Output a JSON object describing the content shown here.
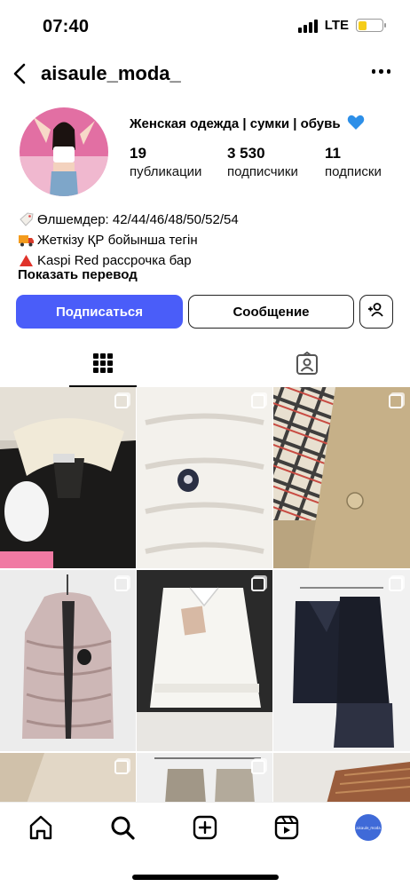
{
  "status_bar": {
    "time": "07:40",
    "network": "LTE",
    "battery_level": 0.35,
    "battery_color": "#f5cd19"
  },
  "header": {
    "username": "aisaule_moda_",
    "back_icon": "chevron-left-icon",
    "more_icon": "more-horizontal-icon"
  },
  "profile": {
    "name": "Женская одежда | сумки | обувь",
    "name_emoji": "blue-heart-icon",
    "stats": [
      {
        "value": "19",
        "label": "публикации"
      },
      {
        "value": "3 530",
        "label": "подписчики"
      },
      {
        "value": "11",
        "label": "подписки"
      }
    ],
    "bio": [
      {
        "icon": "tag-icon",
        "text": "Өлшемдер: 42/44/46/48/50/52/54"
      },
      {
        "icon": "truck-icon",
        "text": "Жеткізу ҚР бойынша тегін"
      },
      {
        "icon": "red-triangle-icon",
        "text": "Kaspi Red рассрочка бар"
      }
    ],
    "translate_link": "Показать перевод"
  },
  "actions": {
    "follow_label": "Подписаться",
    "message_label": "Сообщение",
    "follow_color": "#4a5df9"
  },
  "tabs": [
    {
      "name": "grid-icon",
      "active": true
    },
    {
      "name": "tagged-icon",
      "active": false
    }
  ],
  "grid": {
    "posts": [
      {
        "subject": "black leather jacket with shearling collar"
      },
      {
        "subject": "white puffer detail with logo patch"
      },
      {
        "subject": "beige trench with check lining"
      },
      {
        "subject": "pink puffer vest"
      },
      {
        "subject": "white blouse with lace trim"
      },
      {
        "subject": "black knit set with lace skirt"
      },
      {
        "subject": "beige knit"
      },
      {
        "subject": "grey blazer on hanger"
      },
      {
        "subject": "tweed fabric"
      }
    ]
  },
  "bottom_nav": {
    "items": [
      "home-icon",
      "search-icon",
      "create-icon",
      "reels-icon",
      "profile-icon"
    ],
    "profile_thumb_text": "aisaule_moda"
  }
}
